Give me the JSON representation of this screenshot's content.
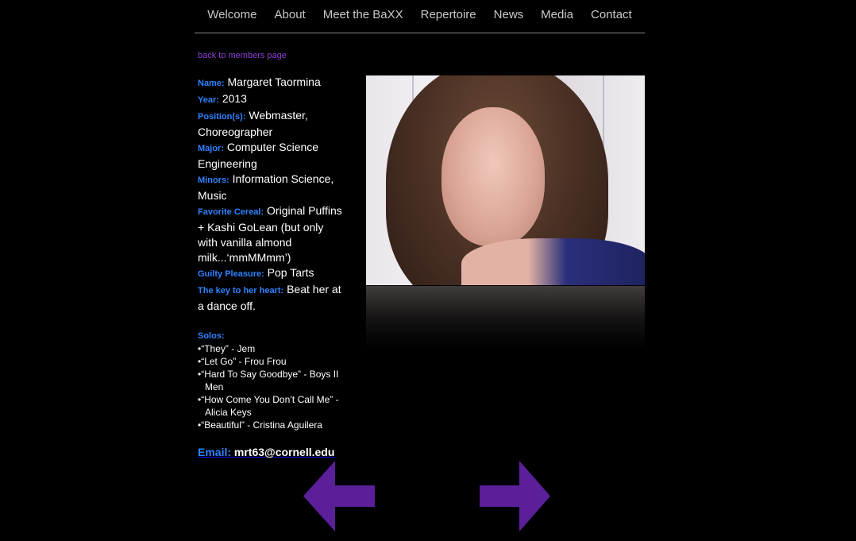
{
  "nav": [
    "Welcome",
    "About",
    "Meet the BaXX",
    "Repertoire",
    "News",
    "Media",
    "Contact"
  ],
  "back_link": "back to members page",
  "profile": {
    "name_label": "Name:",
    "name": "Margaret Taormina",
    "year_label": "Year:",
    "year": "2013",
    "position_label": "Position(s):",
    "position": "Webmaster, Choreographer",
    "major_label": "Major:",
    "major": "Computer Science Engineering",
    "minors_label": "Minors:",
    "minors": "Information Science, Music",
    "cereal_label": "Favorite Cereal:",
    "cereal": "Original Puffins + Kashi GoLean (but only with vanilla almond milk...‘mmMMmm’)",
    "pleasure_label": "Guilty Pleasure:",
    "pleasure": "Pop Tarts",
    "key_label": "The key to her heart:",
    "key": "Beat her at a dance off."
  },
  "solos_label": "Solos:",
  "solos": [
    "“They” - Jem",
    "“Let Go” - Frou Frou",
    "“Hard To Say Goodbye” - Boys II Men",
    "“How Come You Don’t Call Me” - Alicia Keys",
    "“Beautiful” - Cristina Aguilera"
  ],
  "email_label": "Email:",
  "email": "mrt63@cornell.edu",
  "colors": {
    "label": "#2f82ff",
    "link": "#8b3fd6",
    "arrow": "#5a1f99"
  },
  "icons": {
    "prev": "left-arrow-icon",
    "next": "right-arrow-icon"
  }
}
